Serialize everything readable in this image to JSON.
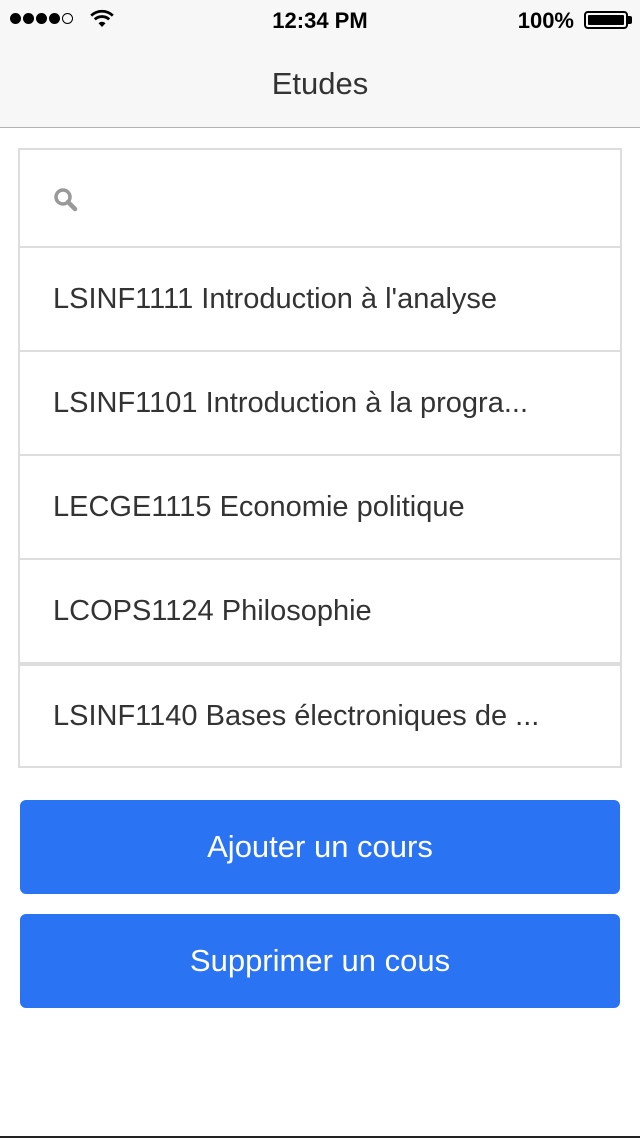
{
  "status_bar": {
    "time": "12:34 PM",
    "battery_percent": "100%",
    "signal_bars_filled": 4,
    "signal_bars_total": 5,
    "battery_level": 1.0
  },
  "navbar": {
    "title": "Etudes"
  },
  "search": {
    "placeholder": "",
    "value": ""
  },
  "courses": [
    {
      "label": "LSINF1111 Introduction à l'analyse"
    },
    {
      "label": "LSINF1101 Introduction à la progra..."
    },
    {
      "label": "LECGE1115 Economie politique"
    },
    {
      "label": "LCOPS1124 Philosophie"
    },
    {
      "label": "LSINF1140 Bases électroniques de ..."
    }
  ],
  "buttons": {
    "add_label": "Ajouter un cours",
    "delete_label": "Supprimer un cous"
  },
  "colors": {
    "accent": "#2a73f2",
    "navbar_bg": "#f7f7f7",
    "border": "#dddddd"
  }
}
